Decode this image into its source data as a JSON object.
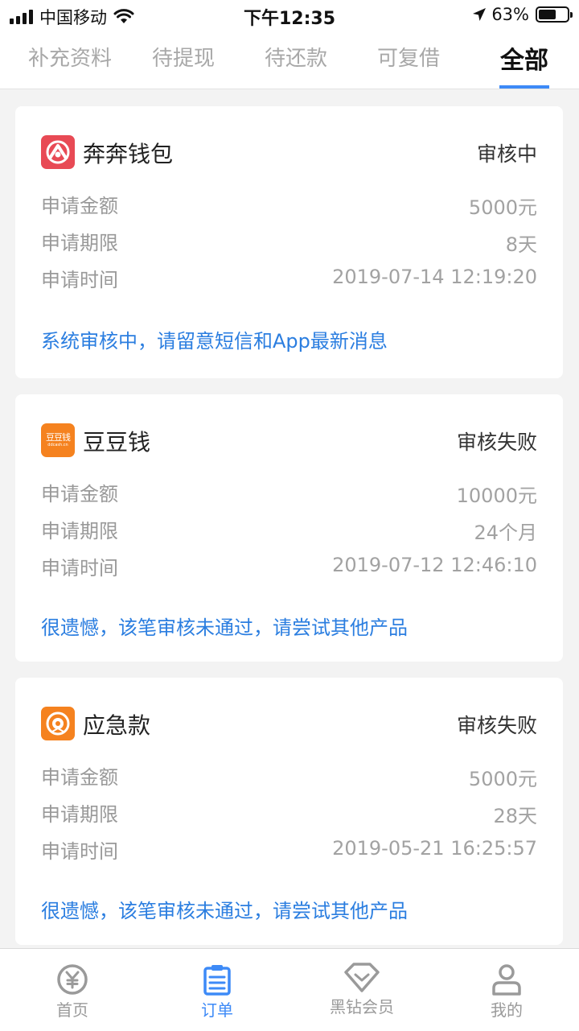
{
  "status_bar": {
    "carrier": "中国移动",
    "time": "下午12:35",
    "battery_percent": "63%",
    "battery_level": 0.63
  },
  "tabs": [
    {
      "label": "补充资料",
      "active": false
    },
    {
      "label": "待提现",
      "active": false
    },
    {
      "label": "待还款",
      "active": false
    },
    {
      "label": "可复借",
      "active": false
    },
    {
      "label": "全部",
      "active": true
    }
  ],
  "accent_color": "#3d8af7",
  "message_color": "#2b7ee0",
  "orders": [
    {
      "app_name": "奔奔钱包",
      "logo_icon": "benben-logo-icon",
      "logo_color": "#e84a55",
      "status": "审核中",
      "rows": [
        {
          "label": "申请金额",
          "value": "5000元"
        },
        {
          "label": "申请期限",
          "value": "8天"
        },
        {
          "label": "申请时间",
          "value": "2019-07-14 12:19:20"
        }
      ],
      "message": "系统审核中，请留意短信和App最新消息"
    },
    {
      "app_name": "豆豆钱",
      "logo_icon": "doudou-logo-icon",
      "logo_color": "#f5821f",
      "logo_text": "豆豆钱",
      "logo_subtext": "ddcash.cn",
      "status": "审核失败",
      "rows": [
        {
          "label": "申请金额",
          "value": "10000元"
        },
        {
          "label": "申请期限",
          "value": "24个月"
        },
        {
          "label": "申请时间",
          "value": "2019-07-12 12:46:10"
        }
      ],
      "message": "很遗憾，该笔审核未通过，请尝试其他产品"
    },
    {
      "app_name": "应急款",
      "logo_icon": "yingji-logo-icon",
      "logo_color": "#f5821f",
      "status": "审核失败",
      "rows": [
        {
          "label": "申请金额",
          "value": "5000元"
        },
        {
          "label": "申请期限",
          "value": "28天"
        },
        {
          "label": "申请时间",
          "value": "2019-05-21 16:25:57"
        }
      ],
      "message": "很遗憾，该笔审核未通过，请尝试其他产品"
    }
  ],
  "bottom_nav": [
    {
      "label": "首页",
      "icon": "yuan-coin-icon",
      "active": false
    },
    {
      "label": "订单",
      "icon": "clipboard-icon",
      "active": true
    },
    {
      "label": "黑钻会员",
      "icon": "diamond-icon",
      "active": false
    },
    {
      "label": "我的",
      "icon": "person-icon",
      "active": false
    }
  ]
}
